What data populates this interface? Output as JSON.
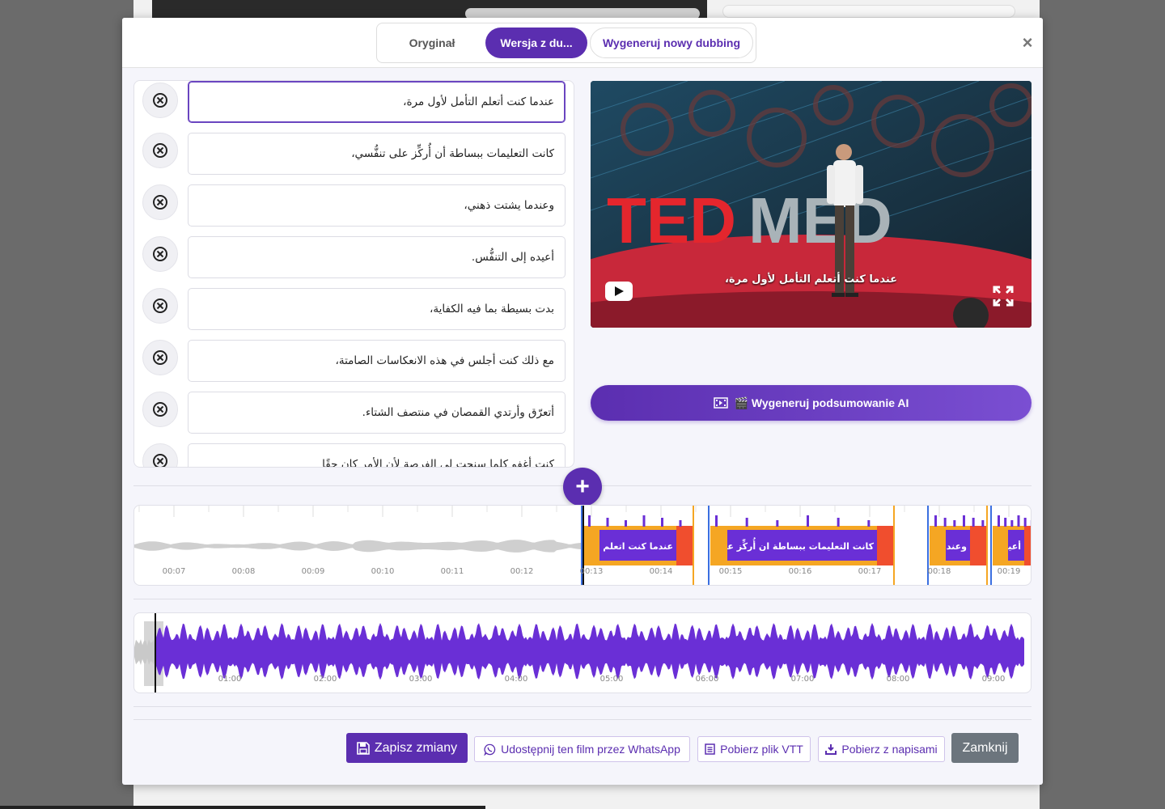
{
  "tabs": {
    "original": "Oryginał",
    "dubbed": "Wersja z du...",
    "generate": "Wygeneruj nowy dubbing"
  },
  "close_symbol": "×",
  "segments": [
    {
      "text": "عندما كنت أتعلم التأمل لأول مرة،",
      "active": true
    },
    {
      "text": "كانت التعليمات ببساطة أن أُركِّز على تنفُّسي،",
      "active": false
    },
    {
      "text": "وعندما يشتت ذهني،",
      "active": false
    },
    {
      "text": "أعيده إلى التنفُّس.",
      "active": false
    },
    {
      "text": "بدت بسيطة بما فيه الكفاية،",
      "active": false
    },
    {
      "text": "مع ذلك كنت أجلس في هذه الانعكاسات الصامتة،",
      "active": false
    },
    {
      "text": "أتعرّق وأرتدي القمصان في منتصف الشتاء.",
      "active": false
    },
    {
      "text": "كنت أغفو كلما سنحت لي الفرصة لأن الأمر كان حقًا",
      "active": false
    }
  ],
  "video": {
    "caption": "عندما كنت أتعلم التأمل لأول مرة،",
    "stage_text_red": "TED",
    "stage_text_gray": "MED"
  },
  "ai_button": {
    "label": "🎬 Wygeneruj podsumowanie AI",
    "icon": "film-icon"
  },
  "add_button": "+",
  "timeline": {
    "ticks": [
      "00:07",
      "00:08",
      "00:09",
      "00:10",
      "00:11",
      "00:12",
      "00:13",
      "00:14",
      "00:15",
      "00:16",
      "00:17",
      "00:18",
      "00:19"
    ],
    "regions": [
      {
        "text": "عندما كنت اتعلم التامل لأول مرة،"
      },
      {
        "text": "كانت التعليمات ببساطة ان أُركِّز على تنفُّسي،"
      },
      {
        "text": "وعندما يشتت"
      },
      {
        "text": "أعيده إلى"
      }
    ]
  },
  "overview": {
    "ticks": [
      "01:00",
      "02:00",
      "03:00",
      "04:00",
      "05:00",
      "06:00",
      "07:00",
      "08:00",
      "09:00"
    ]
  },
  "footer": {
    "save": "Zapisz zmiany",
    "whatsapp": "Udostępnij ten film przez WhatsApp",
    "vtt": "Pobierz plik VTT",
    "subtitles": "Pobierz z napisami",
    "close": "Zamknij"
  },
  "colors": {
    "accent": "#5b2eb0",
    "region_orange": "#f5a623",
    "region_red": "#f04e2e",
    "waveform_purple": "#6a2fd6"
  }
}
